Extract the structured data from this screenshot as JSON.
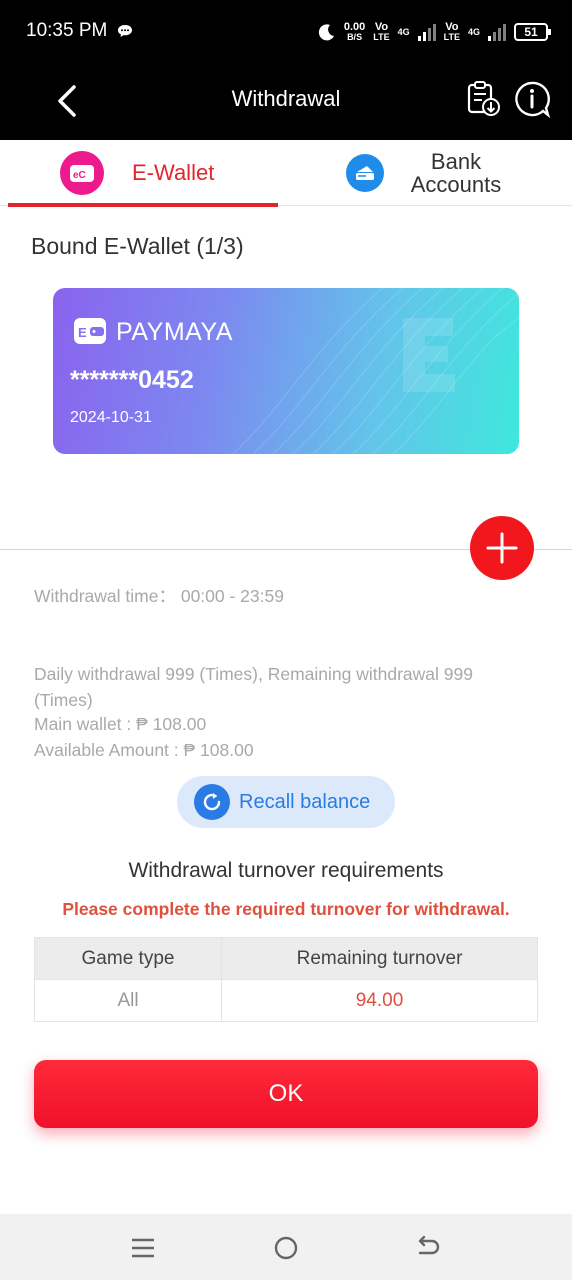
{
  "status_bar": {
    "time": "10:35 PM",
    "net_speed_value": "0.00",
    "net_speed_unit": "B/S",
    "sim1_vo": "Vo",
    "sim1_lte": "LTE",
    "sim1_net": "4G",
    "sim2_vo": "Vo",
    "sim2_lte": "LTE",
    "sim2_net": "4G",
    "battery": "51"
  },
  "header": {
    "title": "Withdrawal",
    "back_icon": "chevron-left-icon",
    "history_icon": "clipboard-history-icon",
    "info_icon": "info-icon"
  },
  "tabs": [
    {
      "label": "E-Wallet",
      "active": true
    },
    {
      "label": "Bank Accounts",
      "active": false
    }
  ],
  "bound": {
    "title": "Bound E-Wallet (1/3)"
  },
  "card": {
    "brand": "PAYMAYA",
    "number": "*******0452",
    "date": "2024-10-31"
  },
  "info": {
    "withdrawal_time": "Withdrawal time：  00:00 - 23:59",
    "daily": "Daily withdrawal 999 (Times), Remaining withdrawal 999 (Times)",
    "main_wallet": "Main wallet : ₱ 108.00",
    "available": "Available Amount : ₱ 108.00"
  },
  "recall_label": "Recall balance",
  "turnover": {
    "title": "Withdrawal turnover requirements",
    "warning": "Please complete the required turnover for withdrawal.",
    "headers": [
      "Game type",
      "Remaining turnover"
    ],
    "rows": [
      {
        "game_type": "All",
        "remaining": "94.00"
      }
    ]
  },
  "ok_label": "OK",
  "colors": {
    "accent_red": "#e2262b",
    "button_red": "#f0102a",
    "blue": "#2b7be4",
    "warning_text": "#e0503d"
  }
}
